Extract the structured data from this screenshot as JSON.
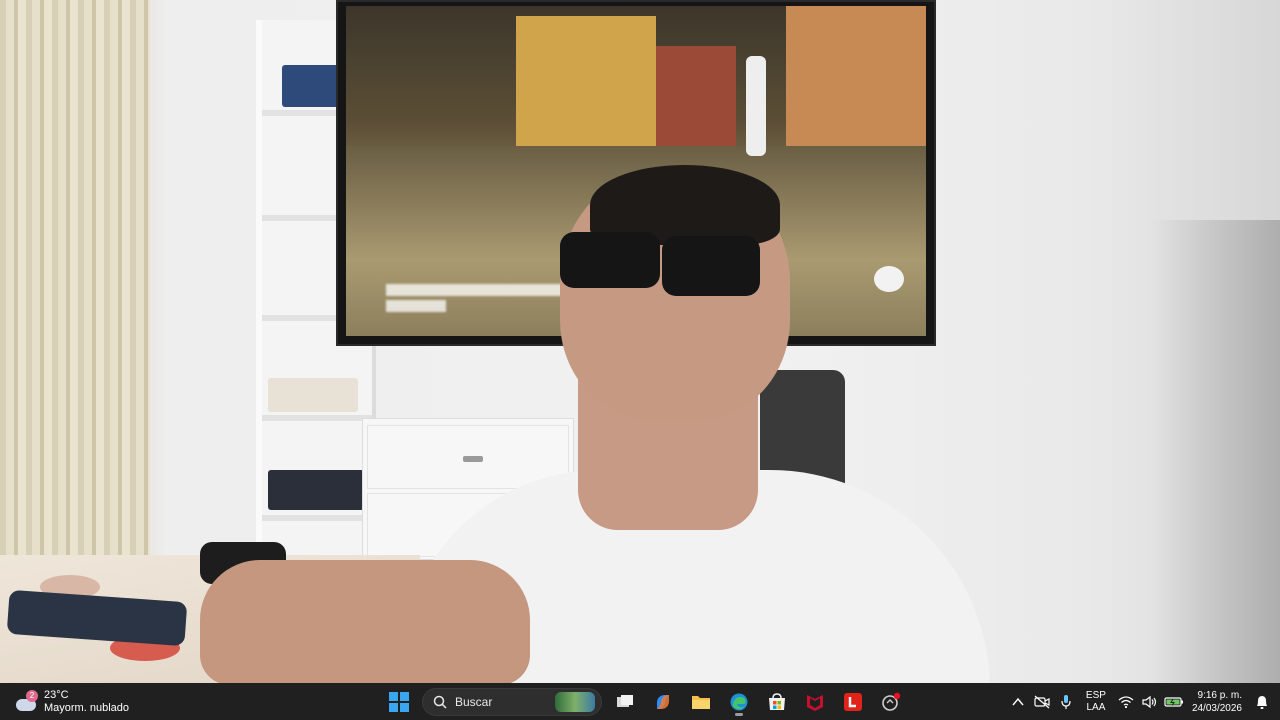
{
  "weather": {
    "temperature": "23°C",
    "condition": "Mayorm. nublado",
    "badge": "2",
    "icon": "cloud-weather-icon"
  },
  "taskbar": {
    "start_icon": "windows-start-icon",
    "search_placeholder": "Buscar",
    "apps": [
      {
        "name": "task-view-icon"
      },
      {
        "name": "copilot-icon"
      },
      {
        "name": "file-explorer-icon"
      },
      {
        "name": "edge-browser-icon"
      },
      {
        "name": "microsoft-store-icon"
      },
      {
        "name": "mcafee-icon"
      },
      {
        "name": "lenovo-app-icon",
        "label": "L"
      },
      {
        "name": "settings-notification-icon"
      }
    ]
  },
  "tray": {
    "chevron_icon": "chevron-up-icon",
    "language": "ESP",
    "layout": "LAA",
    "time": "9:16 p. m.",
    "date": "24/03/2026"
  },
  "colors": {
    "taskbar_bg": "#202020",
    "accent_blue": "#3aa6f0",
    "mcafee_red": "#c8102e"
  }
}
